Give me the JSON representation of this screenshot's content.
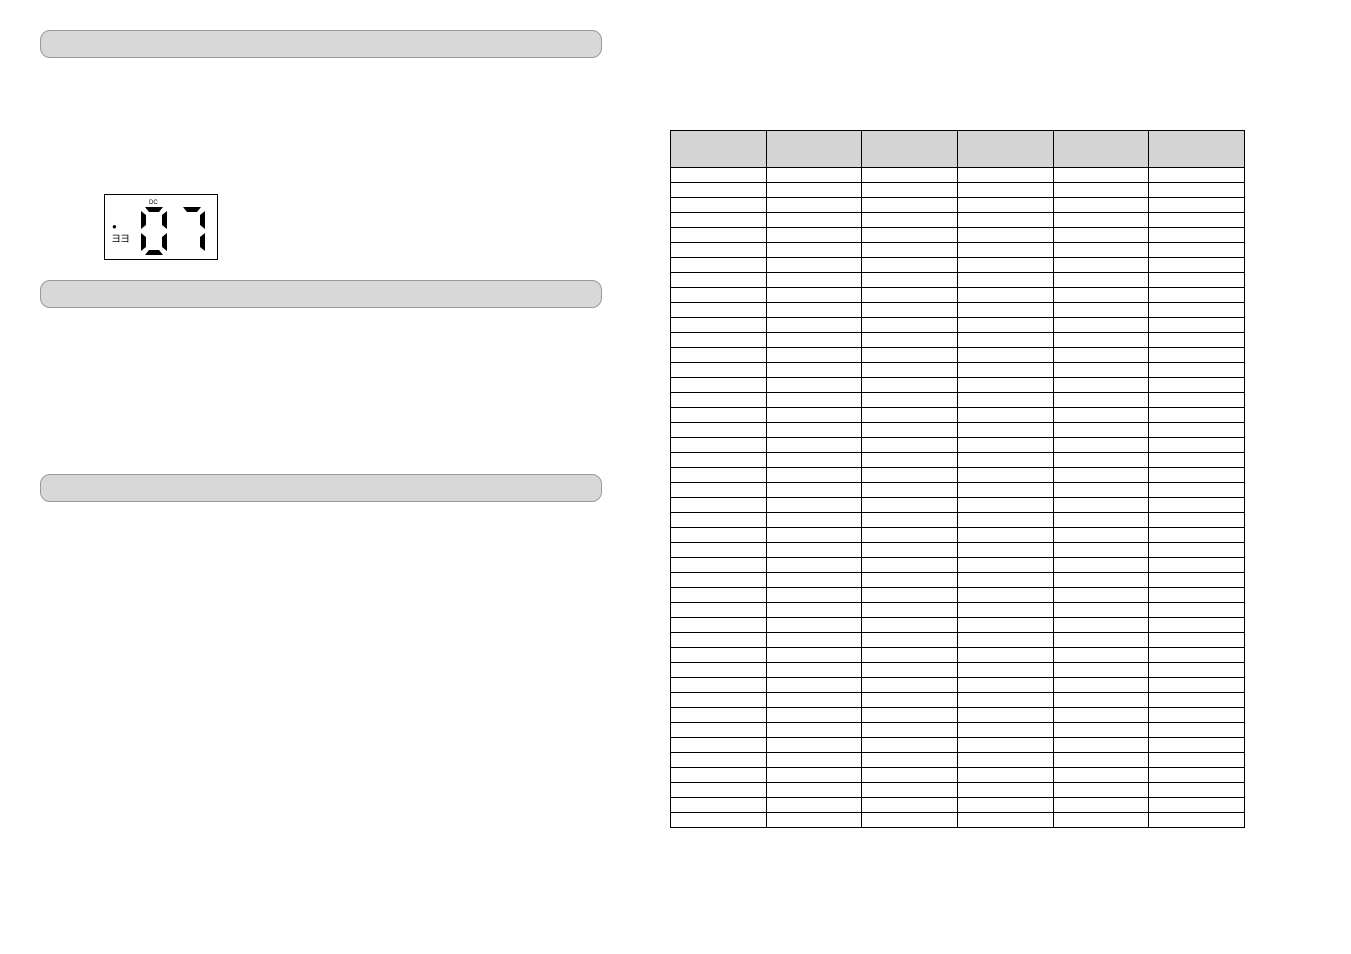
{
  "lcd": {
    "mode_label": "DC",
    "status_symbol": "●",
    "unit_label": "ヨヨ",
    "digits": "07"
  },
  "table": {
    "columns": 6,
    "header_cells": [
      "",
      "",
      "",
      "",
      "",
      ""
    ],
    "row_count": 44
  }
}
